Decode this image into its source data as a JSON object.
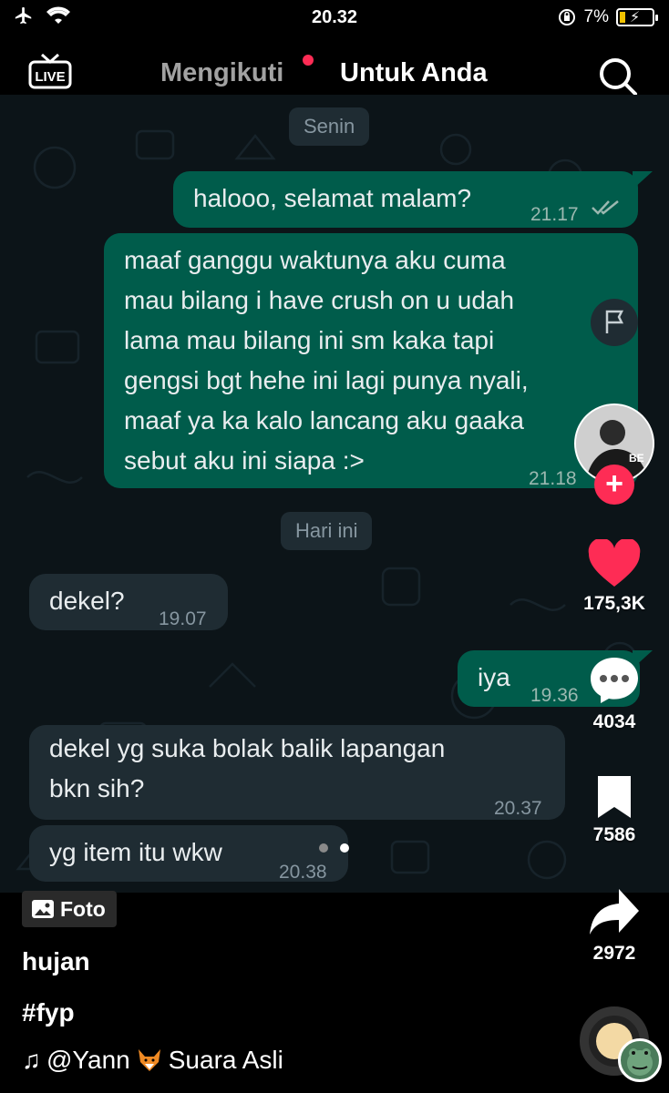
{
  "status_bar": {
    "time": "20.32",
    "battery": "7%"
  },
  "top_nav": {
    "following": "Mengikuti",
    "for_you": "Untuk Anda",
    "live": "LIVE"
  },
  "chat": {
    "date_chip_1": "Senin",
    "date_chip_2": "Hari ini",
    "messages": [
      {
        "text": "halooo, selamat malam?",
        "time": "21.17"
      },
      {
        "lines": [
          "maaf ganggu waktunya aku cuma",
          "mau bilang i have crush on u udah",
          "lama mau bilang ini sm kaka tapi",
          "gengsi bgt hehe ini lagi punya nyali,",
          "maaf ya ka kalo lancang aku gaaka",
          "sebut aku ini siapa :>"
        ],
        "time": "21.18"
      },
      {
        "text": "dekel?",
        "time": "19.07"
      },
      {
        "text": "iya",
        "time": "19.36"
      },
      {
        "lines": [
          "dekel yg suka bolak balik lapangan",
          "bkn sih?"
        ],
        "time": "20.37"
      },
      {
        "text": "yg item itu wkw",
        "time": "20.38"
      }
    ]
  },
  "rail": {
    "likes": "175,3K",
    "comments": "4034",
    "saves": "7586",
    "shares": "2972"
  },
  "post": {
    "badge": "Foto",
    "caption": "hujan",
    "hashtag": "#fyp",
    "music_user": "@Yann",
    "music_name": "Suara Asli"
  },
  "colors": {
    "accent": "#fe2c55",
    "bubble_out": "#005c4b",
    "bubble_in": "#1f2c33",
    "chat_bg": "#0c1418"
  }
}
